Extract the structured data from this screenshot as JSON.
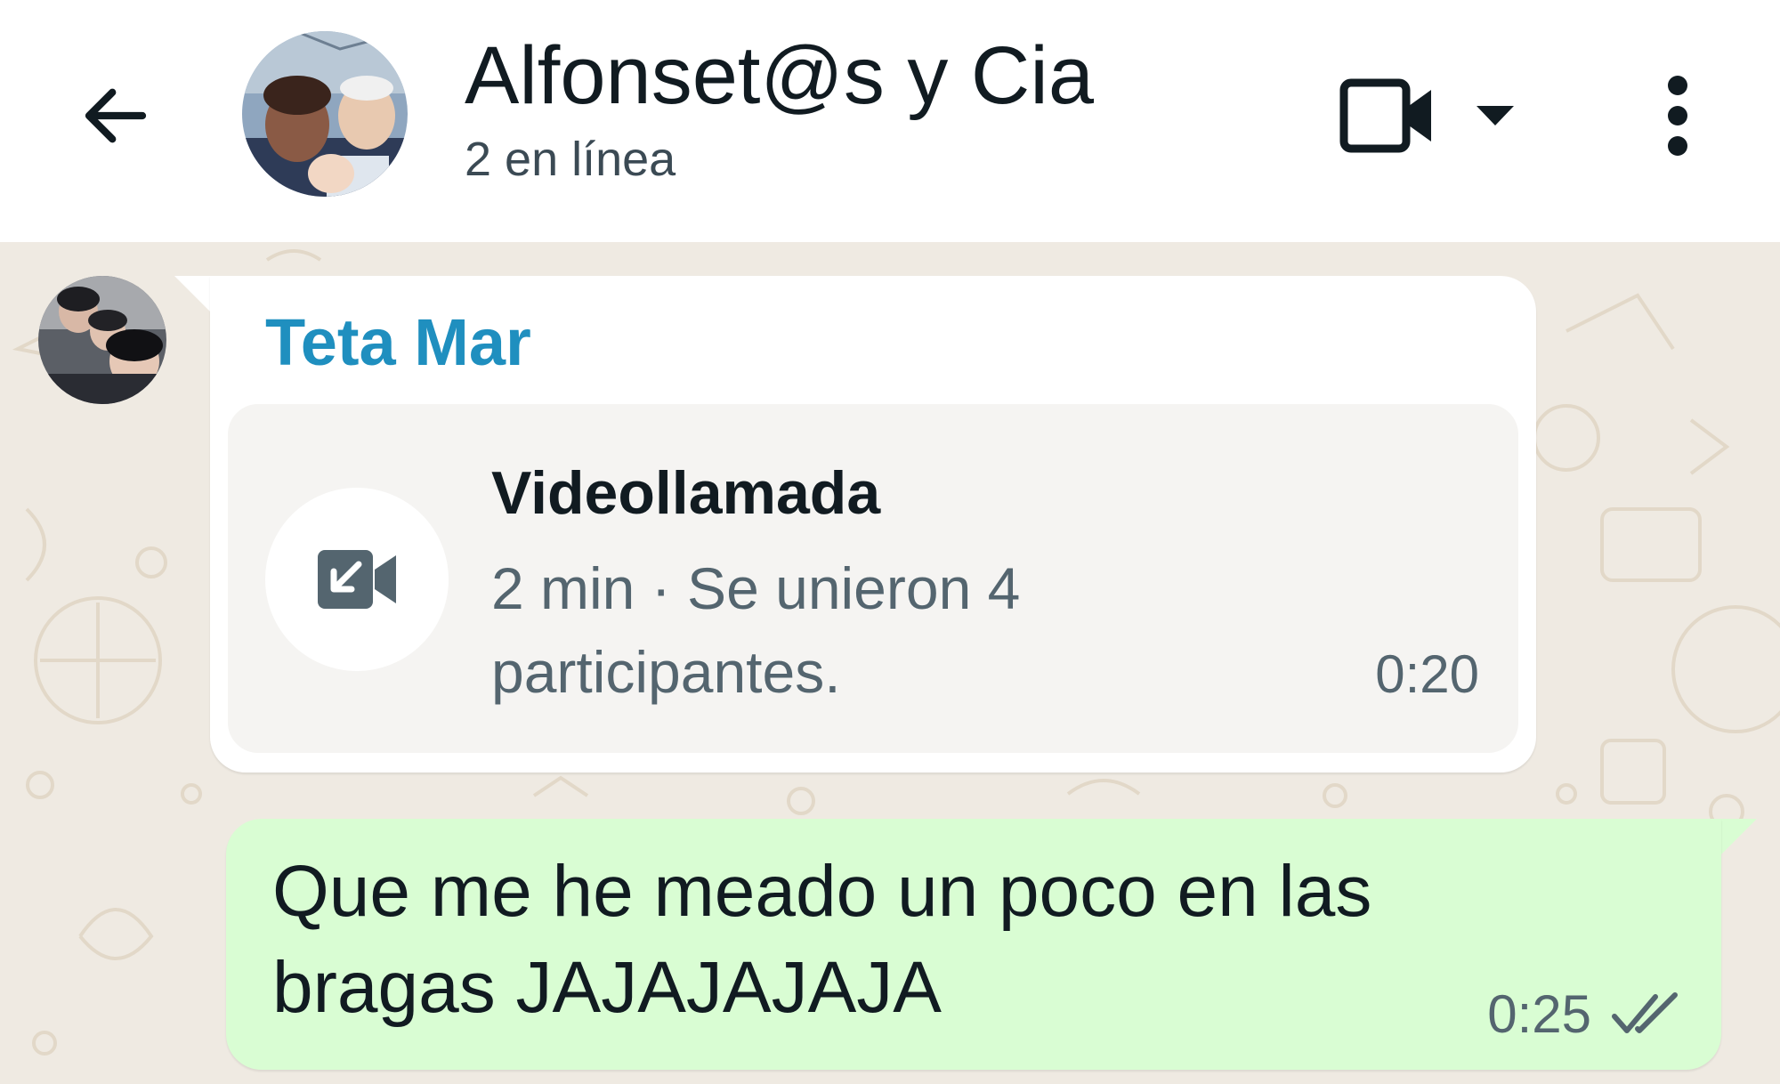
{
  "header": {
    "title": "Alfonset@s y Cia",
    "subtitle": "2 en línea",
    "back_icon": "arrow-left-icon",
    "video_icon": "video-camera-icon",
    "dropdown_icon": "caret-down-icon",
    "menu_icon": "more-vertical-icon"
  },
  "messages": [
    {
      "direction": "incoming",
      "sender": "Teta Mar",
      "sender_color": "#1f8fbf",
      "type": "video-call",
      "call": {
        "icon": "incoming-video-call-icon",
        "title": "Videollamada",
        "detail": "2 min · Se unieron 4 participantes.",
        "time": "0:20"
      }
    },
    {
      "direction": "outgoing",
      "text": "Que me he meado un poco en las bragas JAJAJAJAJA",
      "time": "0:25",
      "status": "delivered",
      "status_icon": "double-check-icon"
    }
  ],
  "colors": {
    "header_bg": "#ffffff",
    "chat_bg": "#efeae2",
    "incoming_bubble": "#ffffff",
    "outgoing_bubble": "#d9fdd3",
    "call_card": "#f5f4f2"
  }
}
